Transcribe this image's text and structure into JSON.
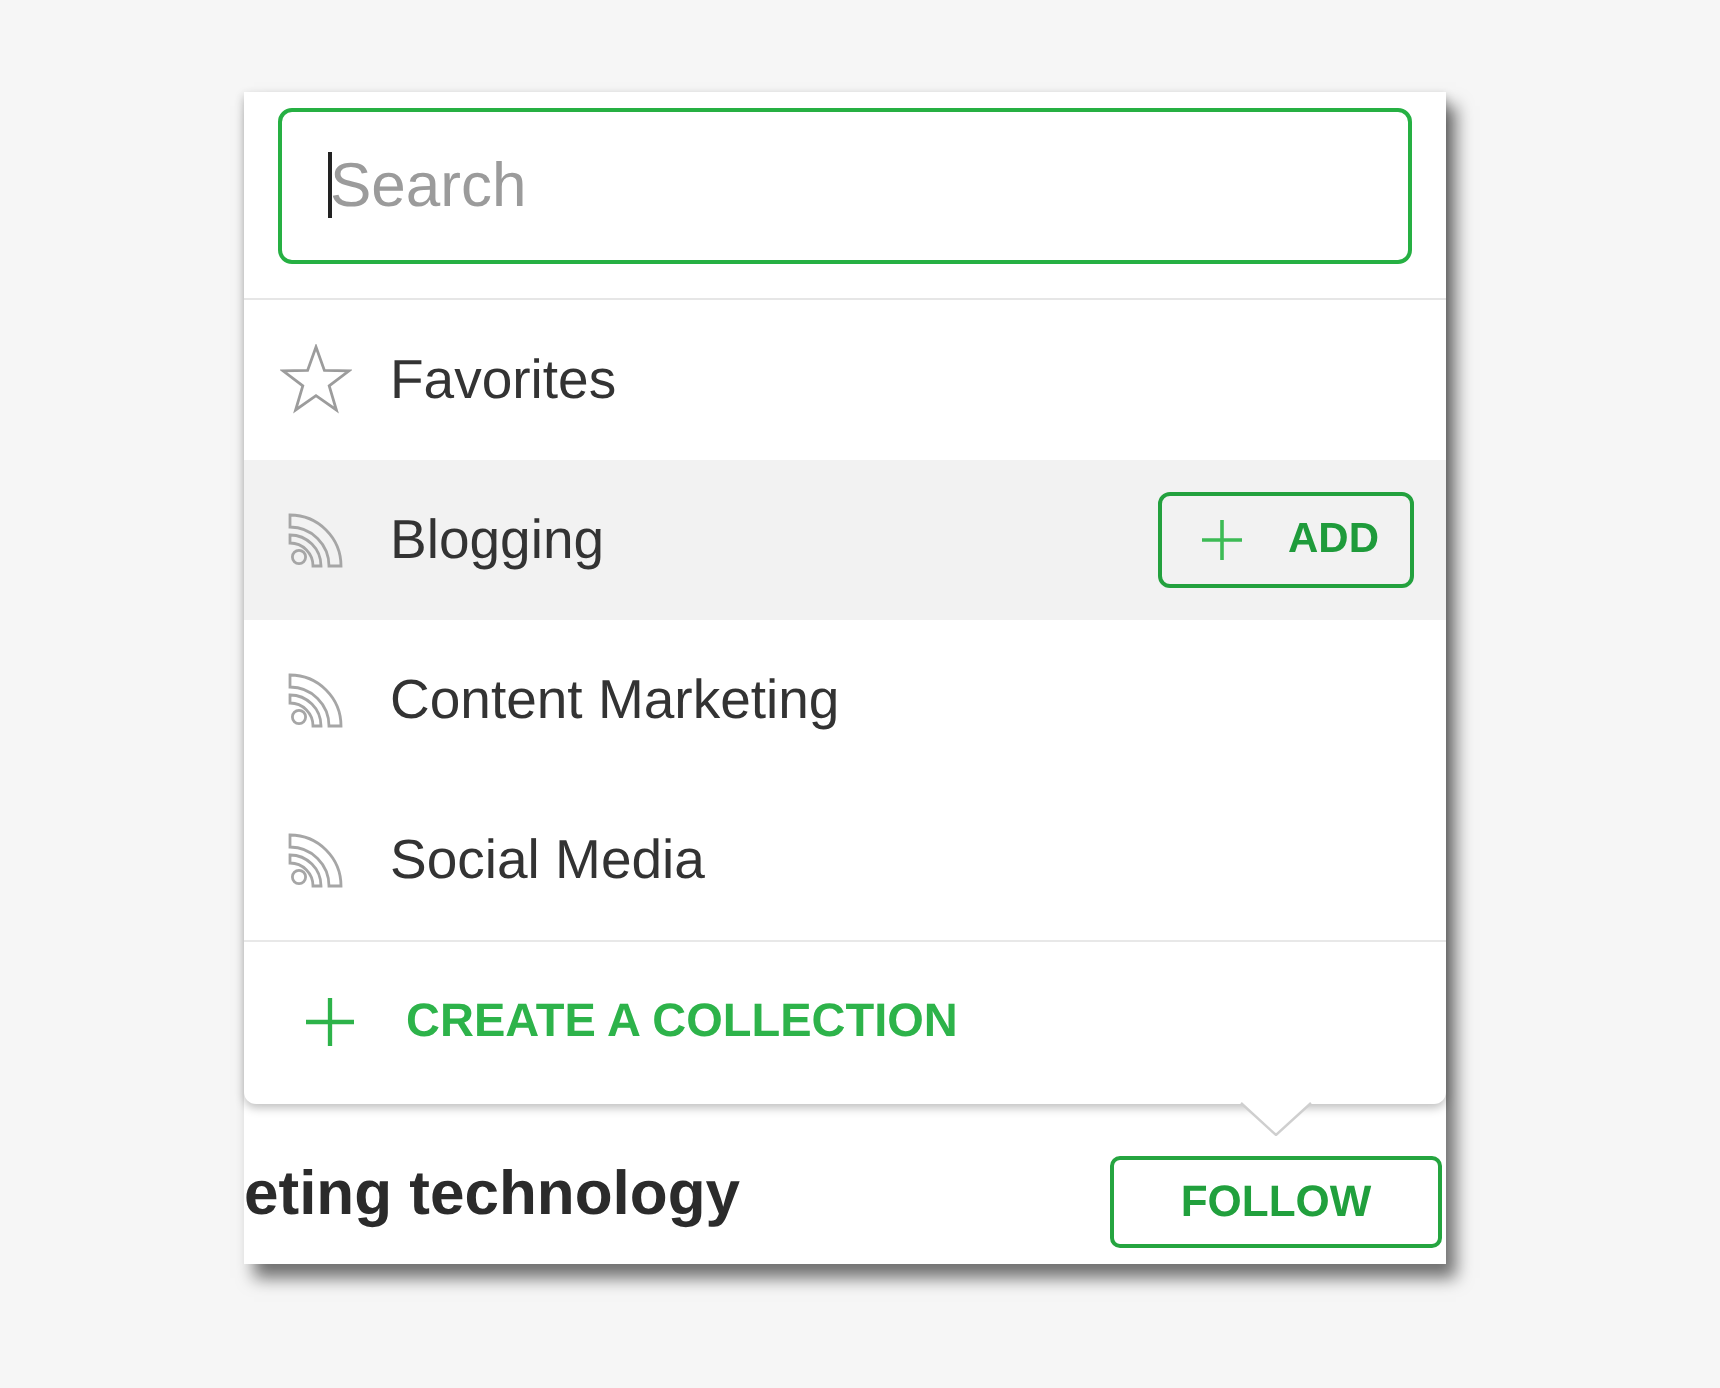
{
  "search": {
    "placeholder": "Search",
    "focused": true
  },
  "collections": [
    {
      "kind": "favorites",
      "label": "Favorites",
      "highlighted": false
    },
    {
      "kind": "feed",
      "label": "Blogging",
      "highlighted": true,
      "button": "ADD"
    },
    {
      "kind": "feed",
      "label": "Content Marketing",
      "highlighted": false
    },
    {
      "kind": "feed",
      "label": "Social Media",
      "highlighted": false
    }
  ],
  "create_collection": {
    "label": "CREATE A COLLECTION"
  },
  "article": {
    "title": "eting technology",
    "follow_button": "FOLLOW"
  }
}
